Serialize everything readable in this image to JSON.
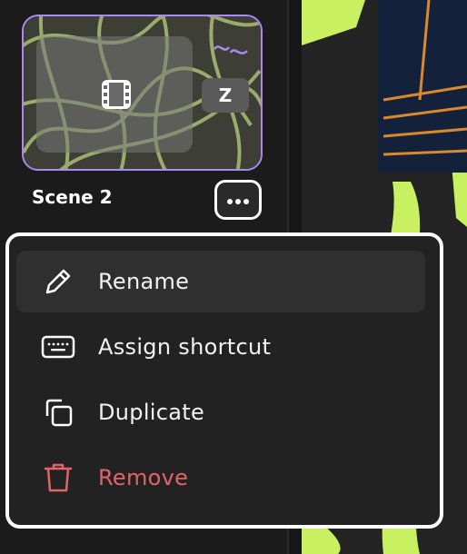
{
  "scene": {
    "name": "Scene 2",
    "shortcut_key": "Z"
  },
  "context_menu": {
    "items": [
      {
        "label": "Rename",
        "icon": "pencil-icon"
      },
      {
        "label": "Assign shortcut",
        "icon": "keyboard-icon"
      },
      {
        "label": "Duplicate",
        "icon": "duplicate-icon"
      },
      {
        "label": "Remove",
        "icon": "trash-icon"
      }
    ]
  },
  "colors": {
    "selection_border": "#a98bf0",
    "danger": "#e26565",
    "accent_lime": "#c8f060"
  }
}
